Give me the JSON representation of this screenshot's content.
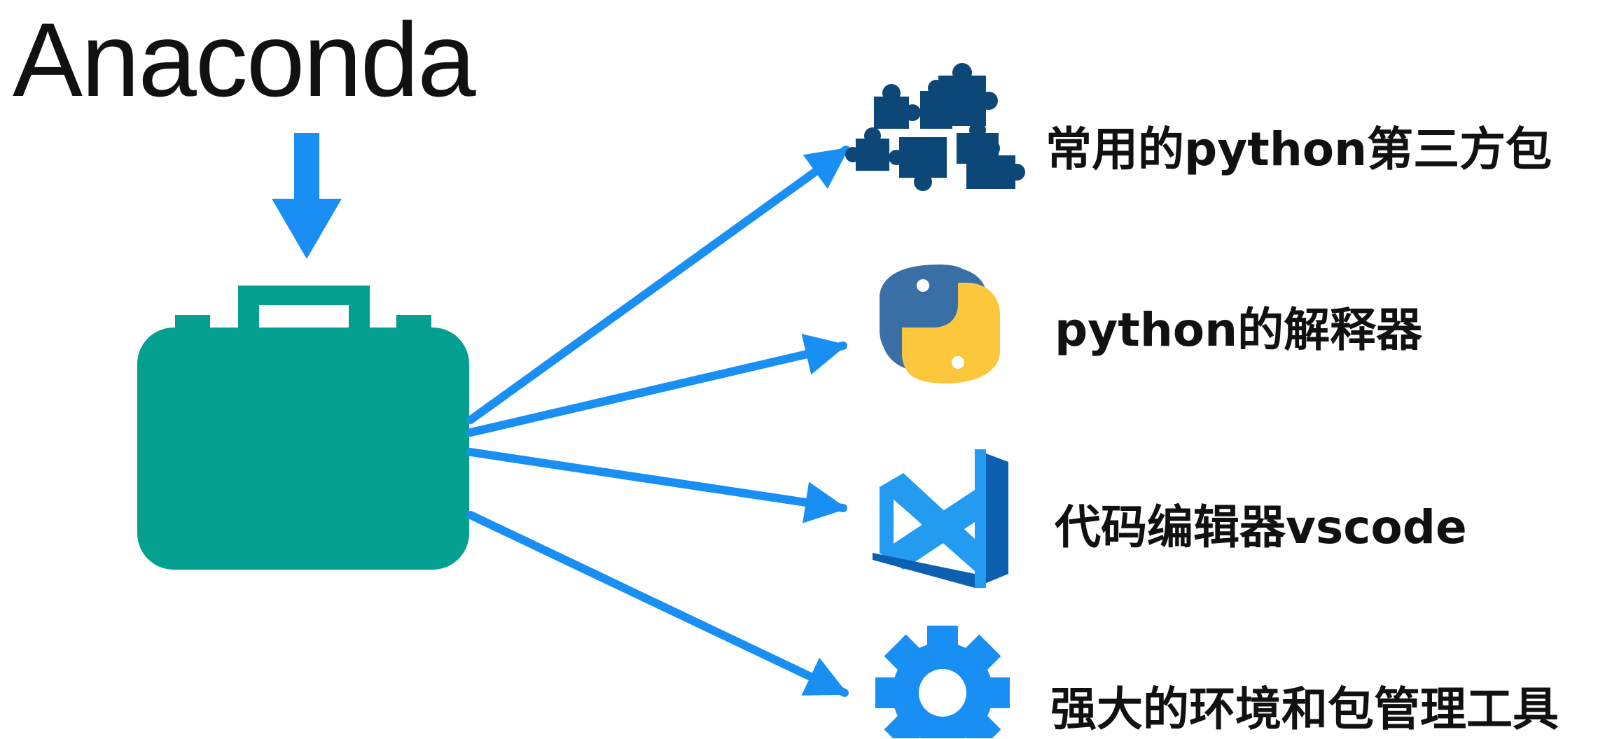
{
  "title": "Anaconda",
  "colors": {
    "arrow": "#1a8ff3",
    "briefcase": "#039f8f",
    "puzzle": "#0c4777",
    "python_blue": "#3a6fa5",
    "python_yellow": "#fcc73c",
    "vscode_light": "#229bf0",
    "vscode_dark": "#0d5fb0",
    "gear": "#1a8ff3",
    "text": "#111111"
  },
  "items": [
    {
      "label": "常用的python第三方包",
      "icon": "puzzle-pieces-icon"
    },
    {
      "label": "python的解释器",
      "icon": "python-logo-icon"
    },
    {
      "label": "代码编辑器vscode",
      "icon": "vscode-logo-icon"
    },
    {
      "label": "强大的环境和包管理工具",
      "icon": "gear-icon"
    }
  ]
}
